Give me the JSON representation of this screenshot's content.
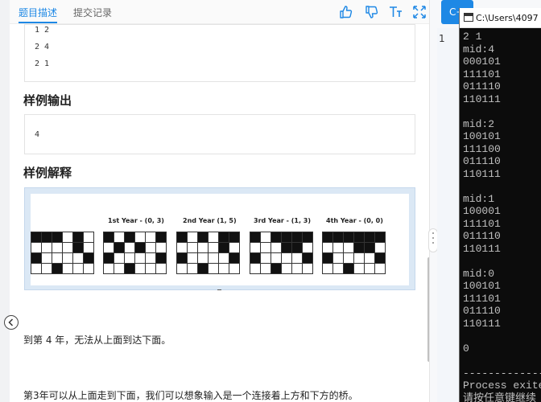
{
  "tabs": {
    "description": "题目描述",
    "submissions": "提交记录"
  },
  "toolbar": {
    "like": "thumb-up-icon",
    "dislike": "thumb-down-icon",
    "font": "font-size-icon",
    "expand": "expand-icon"
  },
  "sample_input_lines": [
    "1 2",
    "2 4",
    "2 1"
  ],
  "sample_output": {
    "heading": "样例输出",
    "value": "4"
  },
  "explanation": {
    "heading": "样例解释",
    "years": [
      {
        "label": "1st Year - (0, 3)",
        "rows": [
          "010110",
          "101011",
          "011110",
          "110111"
        ]
      },
      {
        "label": "2nd Year (1, 5)",
        "rows": [
          "010100",
          "111101",
          "011110",
          "110111"
        ]
      },
      {
        "label": "3rd Year - (1, 3)",
        "rows": [
          "010000",
          "111001",
          "011110",
          "110111"
        ]
      },
      {
        "label": "4th Year - (0, 0)",
        "rows": [
          "000000",
          "111001",
          "011110",
          "110111"
        ]
      }
    ],
    "initial_rows": [
      "000101",
      "111101",
      "011110",
      "110111"
    ]
  },
  "paragraph1": "到第 4 年，无法从上面到达下面。",
  "paragraph2": "第3年可以从上面走到下面，我们可以想象输入是一个连接着上方和下方的桥。",
  "editor": {
    "lang_button": "C++",
    "line_number": "1"
  },
  "console": {
    "title": "C:\\Users\\4097",
    "lines": [
      "2 1",
      "mid:4",
      "000101",
      "111101",
      "011110",
      "110111",
      "",
      "mid:2",
      "100101",
      "111100",
      "011110",
      "110111",
      "",
      "mid:1",
      "100001",
      "111101",
      "011110",
      "110111",
      "",
      "mid:0",
      "100101",
      "111101",
      "011110",
      "110111",
      "",
      "0",
      "",
      "--------------------",
      "Process exite",
      "请按任意键继续"
    ]
  }
}
